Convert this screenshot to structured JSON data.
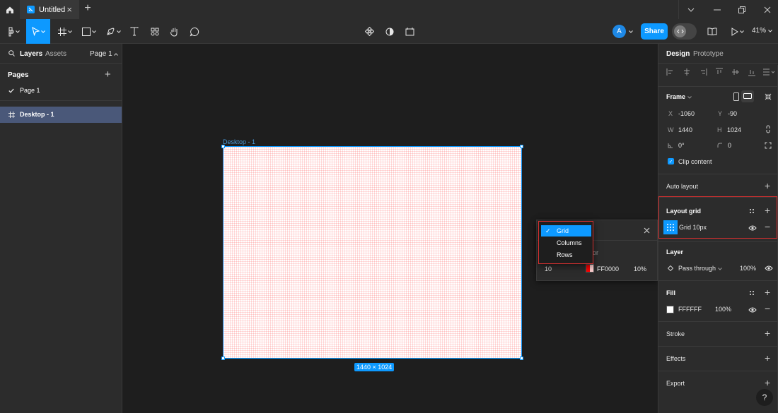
{
  "titlebar": {
    "file_tab_title": "Untitled",
    "close_glyph": "×",
    "new_tab_glyph": "+",
    "window_controls": [
      "chevron-down-icon",
      "minimize-icon",
      "restore-icon",
      "close-icon"
    ]
  },
  "toolbar": {
    "tools": [
      "main-menu",
      "move-tool",
      "frame-tool",
      "shape-tool",
      "pen-tool",
      "text-tool",
      "resources-tool",
      "hand-tool",
      "comment-tool"
    ],
    "avatar_initial": "A",
    "share_label": "Share",
    "zoom_label": "41%"
  },
  "left_panel": {
    "tab_layers": "Layers",
    "tab_assets": "Assets",
    "page_selector": "Page 1",
    "pages_header": "Pages",
    "pages": [
      {
        "label": "Page 1",
        "checked": true
      }
    ],
    "layers": [
      {
        "label": "Desktop - 1",
        "selected": true
      }
    ]
  },
  "canvas": {
    "frame_name": "Desktop - 1",
    "dimension_badge": "1440 × 1024",
    "grid_popup": {
      "label_fragment": "or",
      "size": "10",
      "color": "FF0000",
      "opacity": "10%",
      "grid_types": [
        {
          "label": "Grid",
          "selected": true
        },
        {
          "label": "Columns",
          "selected": false
        },
        {
          "label": "Rows",
          "selected": false
        }
      ]
    }
  },
  "right_panel": {
    "tab_design": "Design",
    "tab_prototype": "Prototype",
    "frame_section": {
      "title": "Frame",
      "x_label": "X",
      "x": "-1060",
      "y_label": "Y",
      "y": "-90",
      "w_label": "W",
      "w": "1440",
      "h_label": "H",
      "h": "1024",
      "rotation": "0°",
      "radius": "0",
      "clip_content_label": "Clip content",
      "clip_content": true
    },
    "auto_layout_title": "Auto layout",
    "layout_grid": {
      "title": "Layout grid",
      "item_label": "Grid 10px"
    },
    "layer_section": {
      "title": "Layer",
      "blend_mode": "Pass through",
      "opacity": "100%"
    },
    "fill_section": {
      "title": "Fill",
      "color": "FFFFFF",
      "opacity": "100%"
    },
    "stroke_title": "Stroke",
    "effects_title": "Effects",
    "export_title": "Export",
    "help_glyph": "?"
  },
  "colors": {
    "accent": "#0d99ff",
    "panel_bg": "#2c2c2c",
    "canvas_bg": "#1e1e1e",
    "highlight_border": "#d32f2f",
    "grid_color": "#FF0000"
  }
}
